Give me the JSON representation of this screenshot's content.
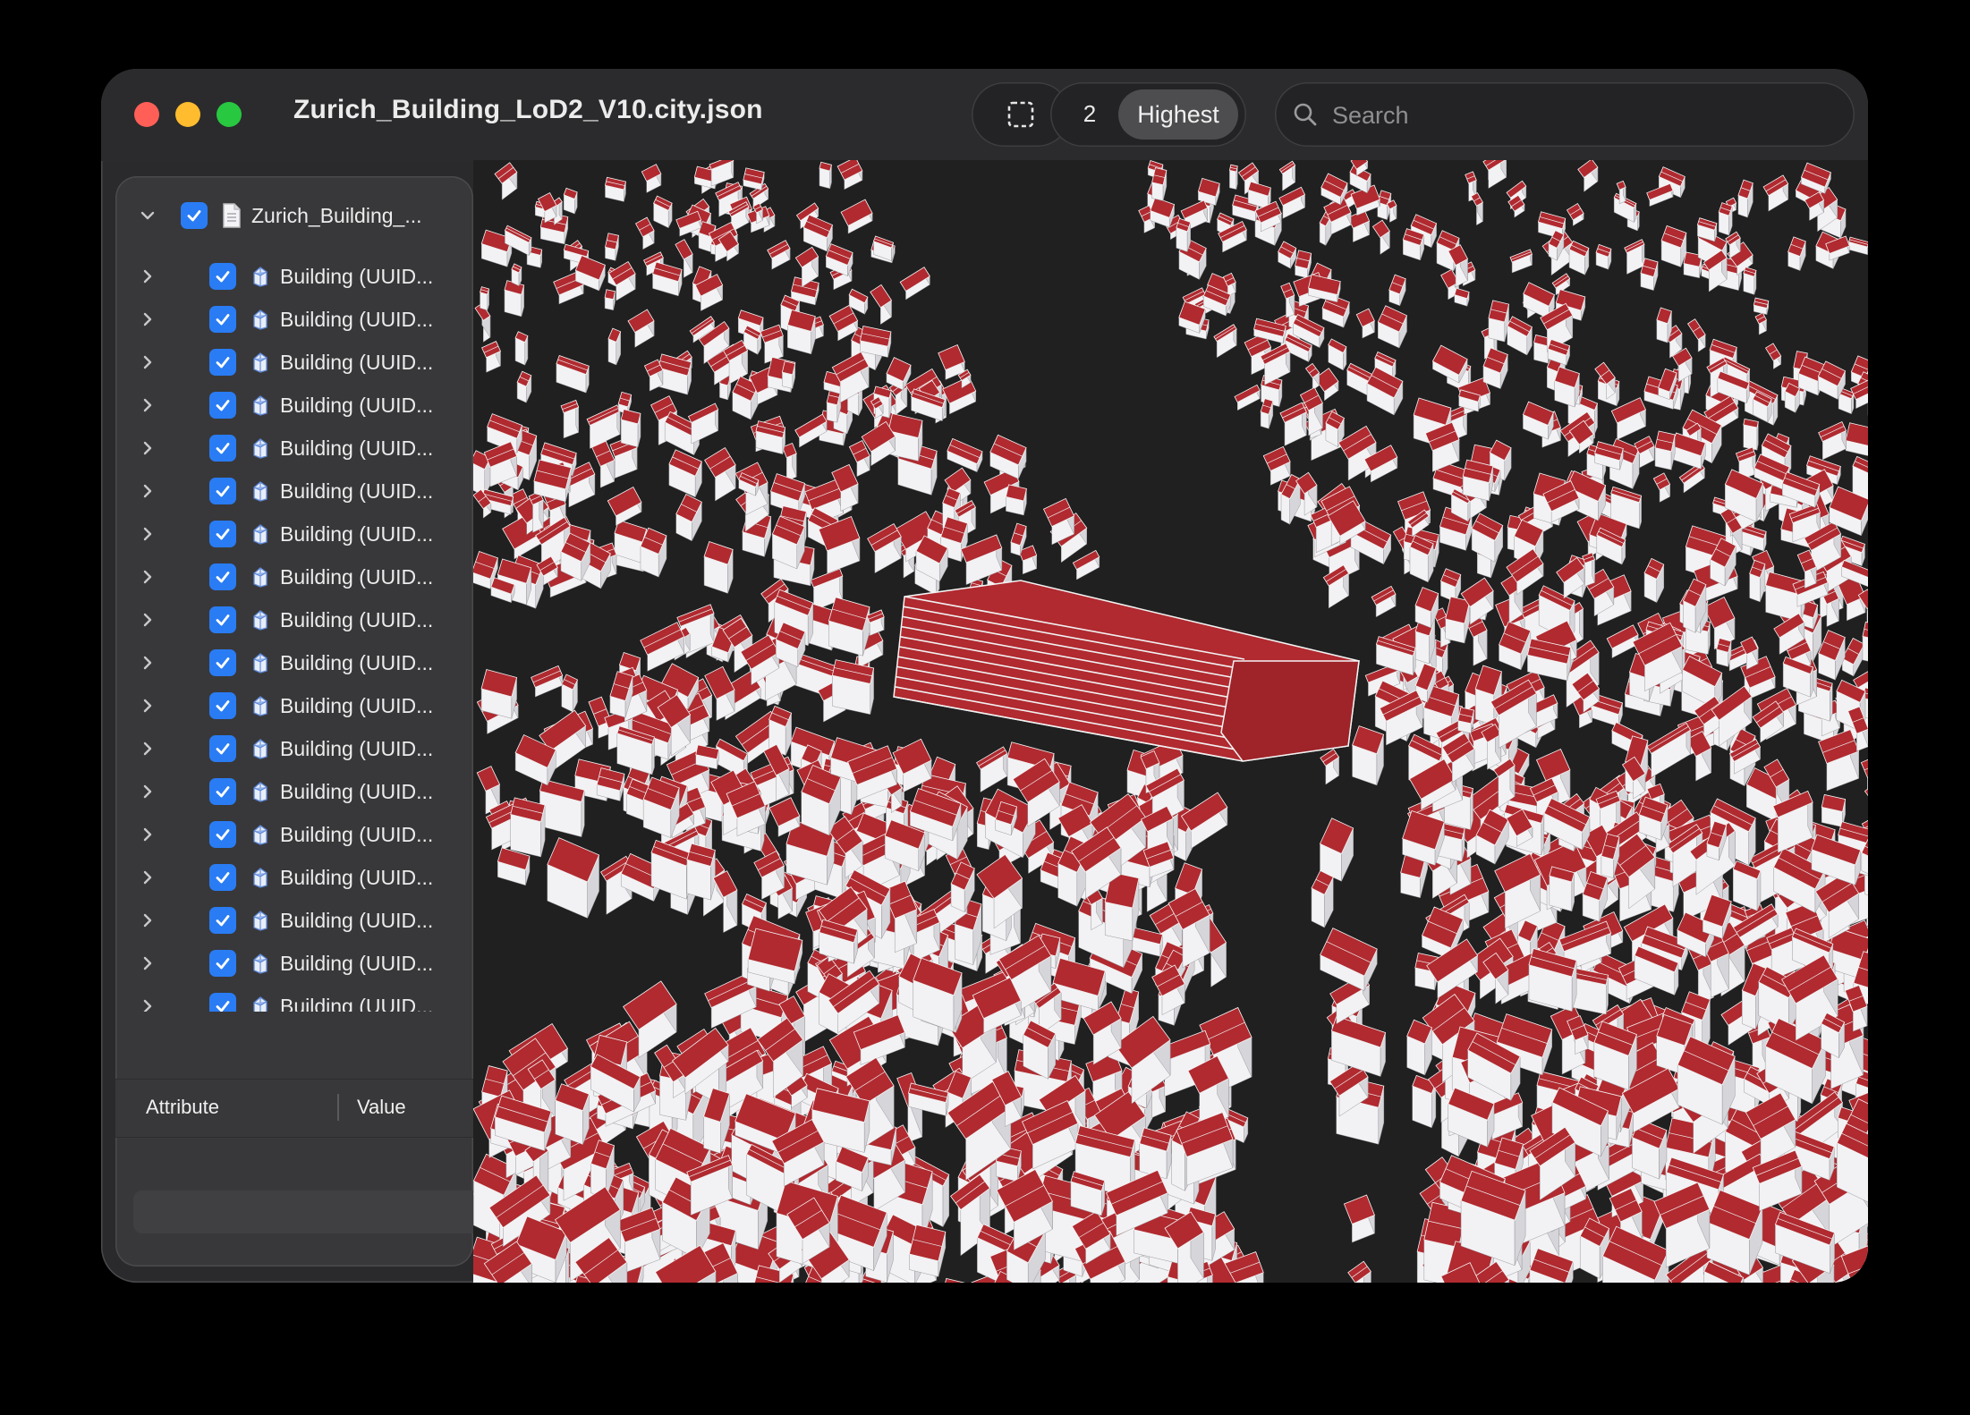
{
  "window": {
    "title": "Zurich_Building_LoD2_V10.city.json"
  },
  "toolbar": {
    "lod_number": "2",
    "lod_quality": "Highest",
    "search_placeholder": "Search"
  },
  "sidebar": {
    "root": {
      "label": "Zurich_Building_...",
      "checked": true
    },
    "items": [
      {
        "label": "Building (UUID..."
      },
      {
        "label": "Building (UUID..."
      },
      {
        "label": "Building (UUID..."
      },
      {
        "label": "Building (UUID..."
      },
      {
        "label": "Building (UUID..."
      },
      {
        "label": "Building (UUID..."
      },
      {
        "label": "Building (UUID..."
      },
      {
        "label": "Building (UUID..."
      },
      {
        "label": "Building (UUID..."
      },
      {
        "label": "Building (UUID..."
      },
      {
        "label": "Building (UUID..."
      },
      {
        "label": "Building (UUID..."
      },
      {
        "label": "Building (UUID..."
      },
      {
        "label": "Building (UUID..."
      },
      {
        "label": "Building (UUID..."
      },
      {
        "label": "Building (UUID..."
      },
      {
        "label": "Building (UUID..."
      },
      {
        "label": "Building (UUID..."
      }
    ]
  },
  "attributes": {
    "col_attribute": "Attribute",
    "col_value": "Value"
  },
  "viewport": {
    "roof_color": "#b02a30",
    "wall_color": "#f2f2f4",
    "ground_color": "#202020"
  }
}
